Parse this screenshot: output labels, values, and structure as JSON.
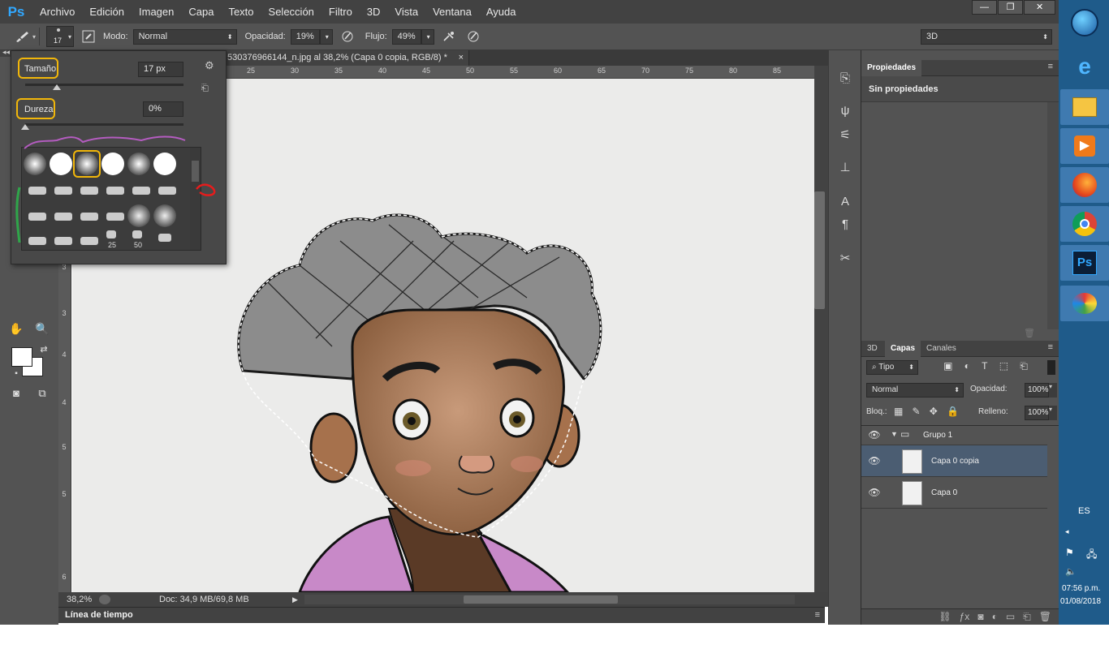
{
  "app": {
    "logo": "Ps"
  },
  "menu": [
    "Archivo",
    "Edición",
    "Imagen",
    "Capa",
    "Texto",
    "Selección",
    "Filtro",
    "3D",
    "Vista",
    "Ventana",
    "Ayuda"
  ],
  "window_controls": {
    "min": "—",
    "max": "❐",
    "close": "✕"
  },
  "options": {
    "brush_size_value": "17",
    "mode_label": "Modo:",
    "mode_value": "Normal",
    "opacity_label": "Opacidad:",
    "opacity_value": "19%",
    "flow_label": "Flujo:",
    "flow_value": "49%",
    "workspace_value": "3D"
  },
  "document": {
    "tab_title": "530376966144_n.jpg al 38,2% (Capa 0 copia, RGB/8) *",
    "tab_close": "×",
    "zoom": "38,2%",
    "doc_info": "Doc: 34,9 MB/69,8 MB"
  },
  "ruler_top": [
    "25",
    "30",
    "35",
    "40",
    "45",
    "50",
    "55",
    "60",
    "65",
    "70",
    "75",
    "80",
    "85"
  ],
  "ruler_left": [
    "3",
    "3",
    "4",
    "4",
    "5",
    "5",
    "6"
  ],
  "brush_popup": {
    "size_label": "Tamaño:",
    "size_value": "17 px",
    "size_level": 0.2,
    "hardness_label": "Dureza",
    "hardness_value": "0%",
    "hardness_level": 0.0,
    "preset_numbers": [
      "25",
      "50"
    ]
  },
  "timeline": {
    "label": "Línea de tiempo"
  },
  "properties": {
    "tab": "Propiedades",
    "content": "Sin propiedades"
  },
  "layers_panel": {
    "tabs": [
      "3D",
      "Capas",
      "Canales"
    ],
    "filter_label": "Tipo",
    "blend_mode": "Normal",
    "opacity_label": "Opacidad:",
    "opacity_value": "100%",
    "lock_label": "Bloq.:",
    "fill_label": "Relleno:",
    "fill_value": "100%",
    "layers": [
      {
        "name": "Grupo 1",
        "type": "group"
      },
      {
        "name": "Capa 0 copia",
        "type": "layer",
        "selected": true
      },
      {
        "name": "Capa 0",
        "type": "layer",
        "selected": false
      }
    ]
  },
  "taskbar": {
    "apps": [
      "windows-start",
      "internet-explorer",
      "file-explorer",
      "media-player",
      "firefox",
      "chrome",
      "photoshop",
      "paint"
    ],
    "language": "ES",
    "time": "07:56 p.m.",
    "date": "01/08/2018"
  },
  "colors": {
    "accent_highlight": "#f2b70a",
    "selection_layer": "#4b5d72",
    "ps_blue": "#31a8ff"
  }
}
